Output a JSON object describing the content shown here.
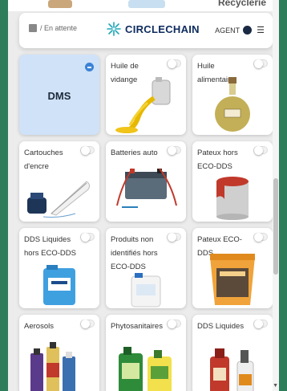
{
  "header": {
    "breadcrumb": "/ En attente",
    "logo_text": "CIRCLECHAIN",
    "user_label": "AGENT"
  },
  "top_peek": {
    "label": "Recyclerie"
  },
  "cards": [
    {
      "label": "DMS",
      "selected": true,
      "icon": "minus-circle-icon"
    },
    {
      "label": "Huile de vidange",
      "icon": "oil-pour-icon"
    },
    {
      "label": "Huile alimentaire",
      "icon": "olive-oil-bottle-icon"
    },
    {
      "label": "Cartouches d'encre",
      "icon": "ink-quill-icon"
    },
    {
      "label": "Batteries auto",
      "icon": "car-battery-icon"
    },
    {
      "label": "Pateux hors ECO-DDS",
      "icon": "paint-can-icon"
    },
    {
      "label": "DDS Liquides hors ECO-DDS",
      "icon": "liquid-canister-icon"
    },
    {
      "label": "Produits non identifiés hors ECO-DDS",
      "icon": "unknown-canister-icon"
    },
    {
      "label": "Pateux ECO-DDS",
      "icon": "sealant-bucket-icon"
    },
    {
      "label": "Aerosols",
      "icon": "spray-cans-icon"
    },
    {
      "label": "Phytosanitaires",
      "icon": "pesticide-bottles-icon"
    },
    {
      "label": "DDS Liquides",
      "icon": "liquid-bottles-icon"
    }
  ],
  "colors": {
    "accent": "#3b82d6",
    "selected_card": "#cfe2f8",
    "brand": "#0d2b5e",
    "frame": "#2e7d5a"
  }
}
